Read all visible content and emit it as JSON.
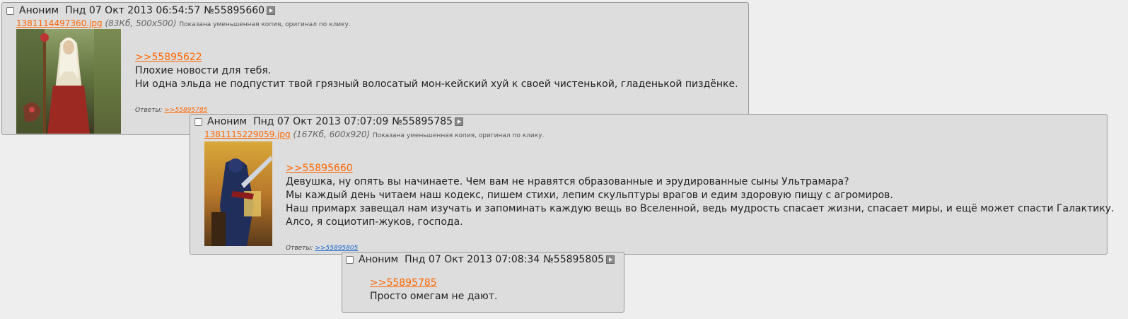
{
  "colors": {
    "page_bg": "#eeeeee",
    "post_bg": "#dddddd",
    "link": "#ff6600",
    "visited_link": "#1a66cc"
  },
  "posts": [
    {
      "author": "Аноним",
      "date": "Пнд 07 Окт 2013 06:54:57",
      "number": "№55895660",
      "file": {
        "name": "1381114497360.jpg",
        "meta": "(83Кб, 500x500)",
        "hint": "Показана уменьшенная копия, оригинал по клику."
      },
      "reply_to": ">>55895622",
      "lines": [
        "Плохие новости для тебя.",
        "Ни одна эльда не подпустит твой грязный волосатый мон-кейский хуй к своей чистенькой, гладенькой пиздёнке."
      ],
      "replies_label": "Ответы:",
      "replies": [
        ">>55895785"
      ]
    },
    {
      "author": "Аноним",
      "date": "Пнд 07 Окт 2013 07:07:09",
      "number": "№55895785",
      "file": {
        "name": "1381115229059.jpg",
        "meta": "(167Кб, 600x920)",
        "hint": "Показана уменьшенная копия, оригинал по клику."
      },
      "reply_to": ">>55895660",
      "lines": [
        "Девушка, ну опять вы начинаете. Чем вам не нравятся образованные и эрудированные сыны Ультрамара?",
        "Мы каждый день читаем наш кодекс, пишем стихи, лепим скульптуры врагов и едим здоровую пищу с агромиров.",
        "Наш примарх завещал нам изучать и запоминать каждую вещь во Вселенной, ведь мудрость спасает жизни, спасает миры, и ещё может спасти Галактику.",
        "Алсо, я социотип-жуков, господа."
      ],
      "replies_label": "Ответы:",
      "replies": [
        ">>55895805"
      ]
    },
    {
      "author": "Аноним",
      "date": "Пнд 07 Окт 2013 07:08:34",
      "number": "№55895805",
      "reply_to": ">>55895785",
      "lines": [
        "Просто омегам не дают."
      ]
    }
  ]
}
